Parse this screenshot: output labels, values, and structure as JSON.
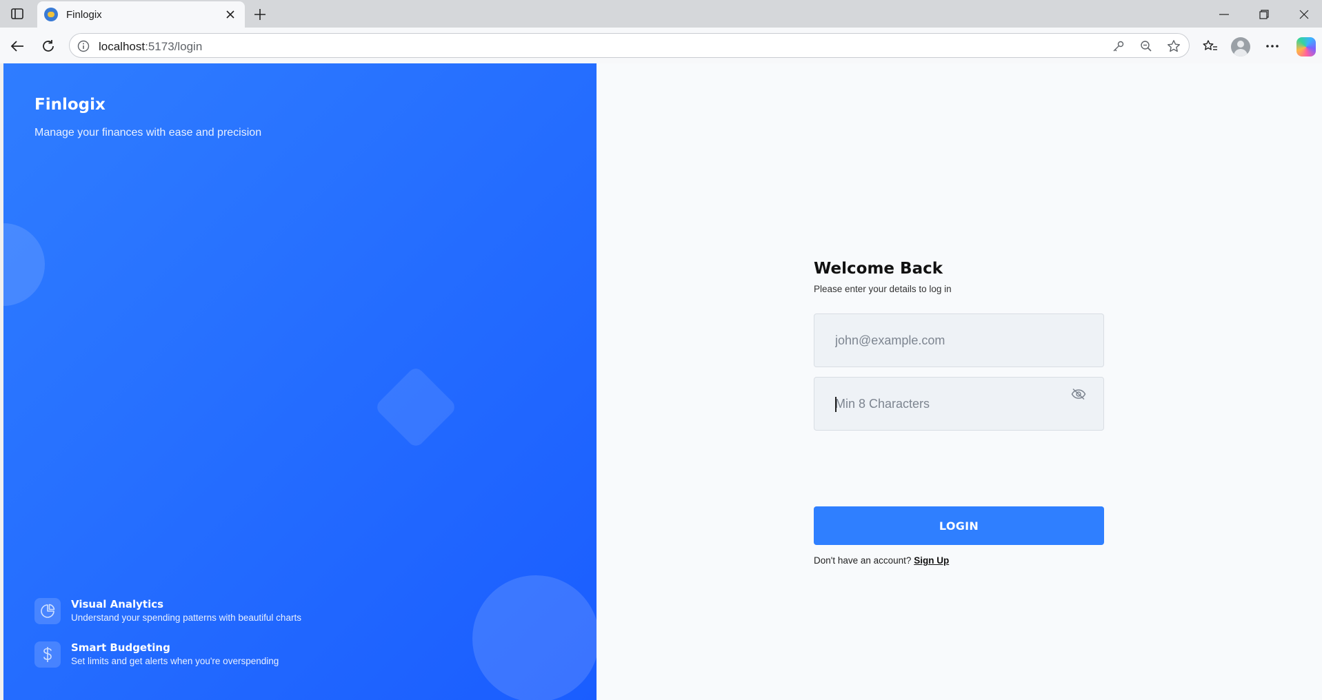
{
  "browser": {
    "tab_title": "Finlogix",
    "url_host": "localhost",
    "url_path": ":5173/login"
  },
  "left": {
    "brand": "Finlogix",
    "tagline": "Manage your finances with ease and precision",
    "features": [
      {
        "icon": "pie-chart-icon",
        "title": "Visual Analytics",
        "description": "Understand your spending patterns with beautiful charts"
      },
      {
        "icon": "dollar-icon",
        "title": "Smart Budgeting",
        "description": "Set limits and get alerts when you're overspending"
      }
    ]
  },
  "form": {
    "title": "Welcome Back",
    "subtitle": "Please enter your details to log in",
    "email_placeholder": "john@example.com",
    "email_value": "",
    "password_placeholder": "Min 8 Characters",
    "password_value": "",
    "login_label": "LOGIN",
    "signup_prompt": "Don't have an account?",
    "signup_link": "Sign Up"
  },
  "colors": {
    "panel_gradient_start": "#2f7dff",
    "panel_gradient_end": "#1a5dff",
    "button": "#2f7fff",
    "page_bg": "#f8fafc"
  }
}
